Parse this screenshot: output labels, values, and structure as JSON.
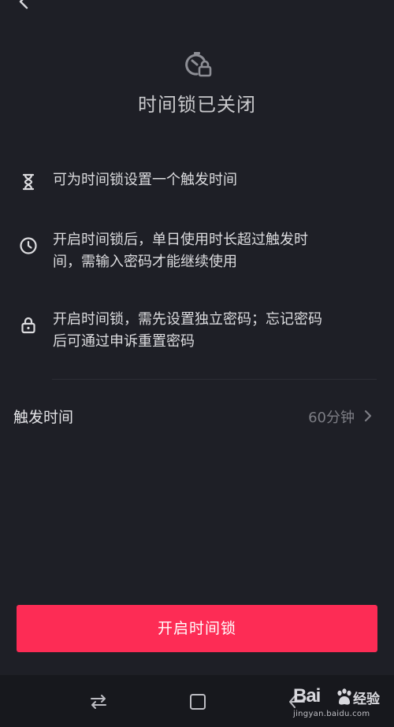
{
  "header": {
    "status_title": "时间锁已关闭",
    "hero_icon": "timer-lock-icon"
  },
  "features": [
    {
      "icon": "hourglass-icon",
      "text": "可为时间锁设置一个触发时间"
    },
    {
      "icon": "clock-icon",
      "lines": [
        "开启时间锁后，单日使用时长超过触发时",
        "间，需输入密码才能继续使用"
      ]
    },
    {
      "icon": "lock-icon",
      "lines": [
        "开启时间锁，需先设置独立密码；忘记密码",
        "后可通过申诉重置密码"
      ]
    }
  ],
  "settings": {
    "trigger_time_label": "触发时间",
    "trigger_time_value": "60分钟"
  },
  "primary_action": {
    "label": "开启时间锁",
    "color": "#fd2c55"
  },
  "system_nav": {
    "items": [
      "recent-apps-icon",
      "home-icon",
      "back-icon"
    ]
  },
  "watermark": {
    "brand": "Bai",
    "brand_suffix": "经验",
    "url": "jingyan.baidu.com"
  },
  "colors": {
    "background": "#1e1f26",
    "accent": "#fd2c55",
    "muted_text": "#7d7e85"
  }
}
